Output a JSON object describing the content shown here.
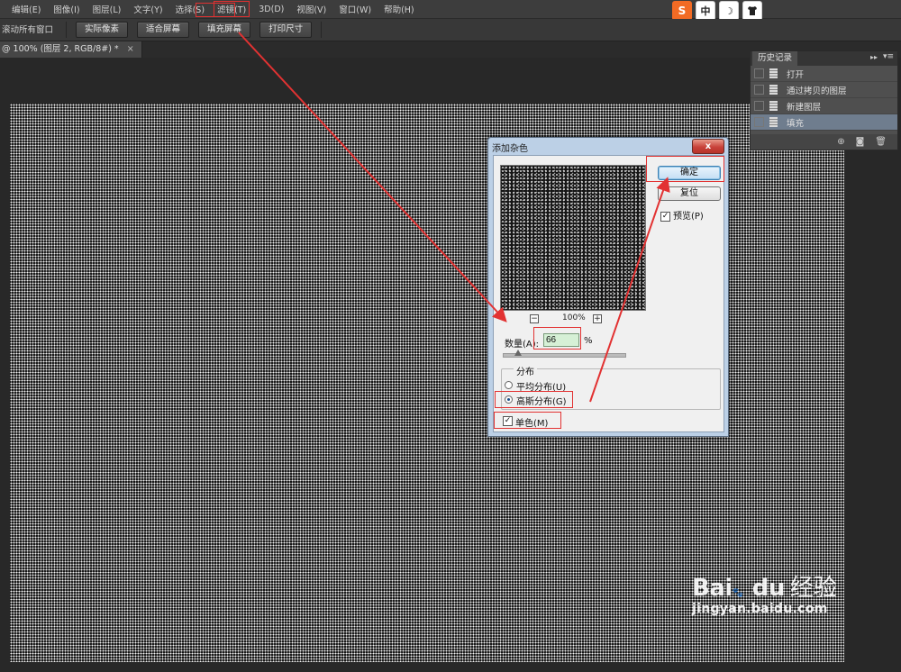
{
  "menu": {
    "items": [
      "编辑(E)",
      "图像(I)",
      "图层(L)",
      "文字(Y)",
      "选择(S)",
      "滤镜(T)",
      "3D(D)",
      "视图(V)",
      "窗口(W)",
      "帮助(H)"
    ]
  },
  "ime": {
    "items": [
      "S",
      "中",
      "☽",
      "👕"
    ]
  },
  "options": {
    "scroll_all": "滚动所有窗口",
    "buttons": [
      "实际像素",
      "适合屏幕",
      "填充屏幕",
      "打印尺寸"
    ]
  },
  "doc_tab": {
    "title": "@ 100% (图层 2, RGB/8#) *",
    "close": "×"
  },
  "history": {
    "title": "历史记录",
    "collapse": "▸▸",
    "menu": "▾≡",
    "items": [
      {
        "label": "打开",
        "active": false
      },
      {
        "label": "通过拷贝的图层",
        "active": false
      },
      {
        "label": "新建图层",
        "active": false
      },
      {
        "label": "填充",
        "active": true
      }
    ],
    "footer_icons": [
      "new-snapshot-icon",
      "camera-icon",
      "trash-icon"
    ]
  },
  "dialog": {
    "title": "添加杂色",
    "close": "x",
    "ok": "确定",
    "reset": "复位",
    "preview_label": "预览(P)",
    "zoom_minus": "−",
    "zoom_plus": "+",
    "zoom": "100%",
    "amount_label": "数量(A):",
    "amount_value": "66",
    "amount_unit": "%",
    "amount_slider_fraction": 0.16,
    "distribution_label": "分布",
    "uniform_label": "平均分布(U)",
    "gaussian_label": "高斯分布(G)",
    "mono_label": "单色(M)",
    "selected_distribution": "gaussian",
    "mono_checked": true,
    "preview_checked": true
  },
  "watermark": {
    "logo": "Bai",
    "logo2": "du",
    "jy": "经验",
    "url": "jingyan.baidu.com"
  },
  "colors": {
    "annotation": "#e23232",
    "ps_dark": "#282828",
    "dialog_frame": "#bcd0e6"
  }
}
